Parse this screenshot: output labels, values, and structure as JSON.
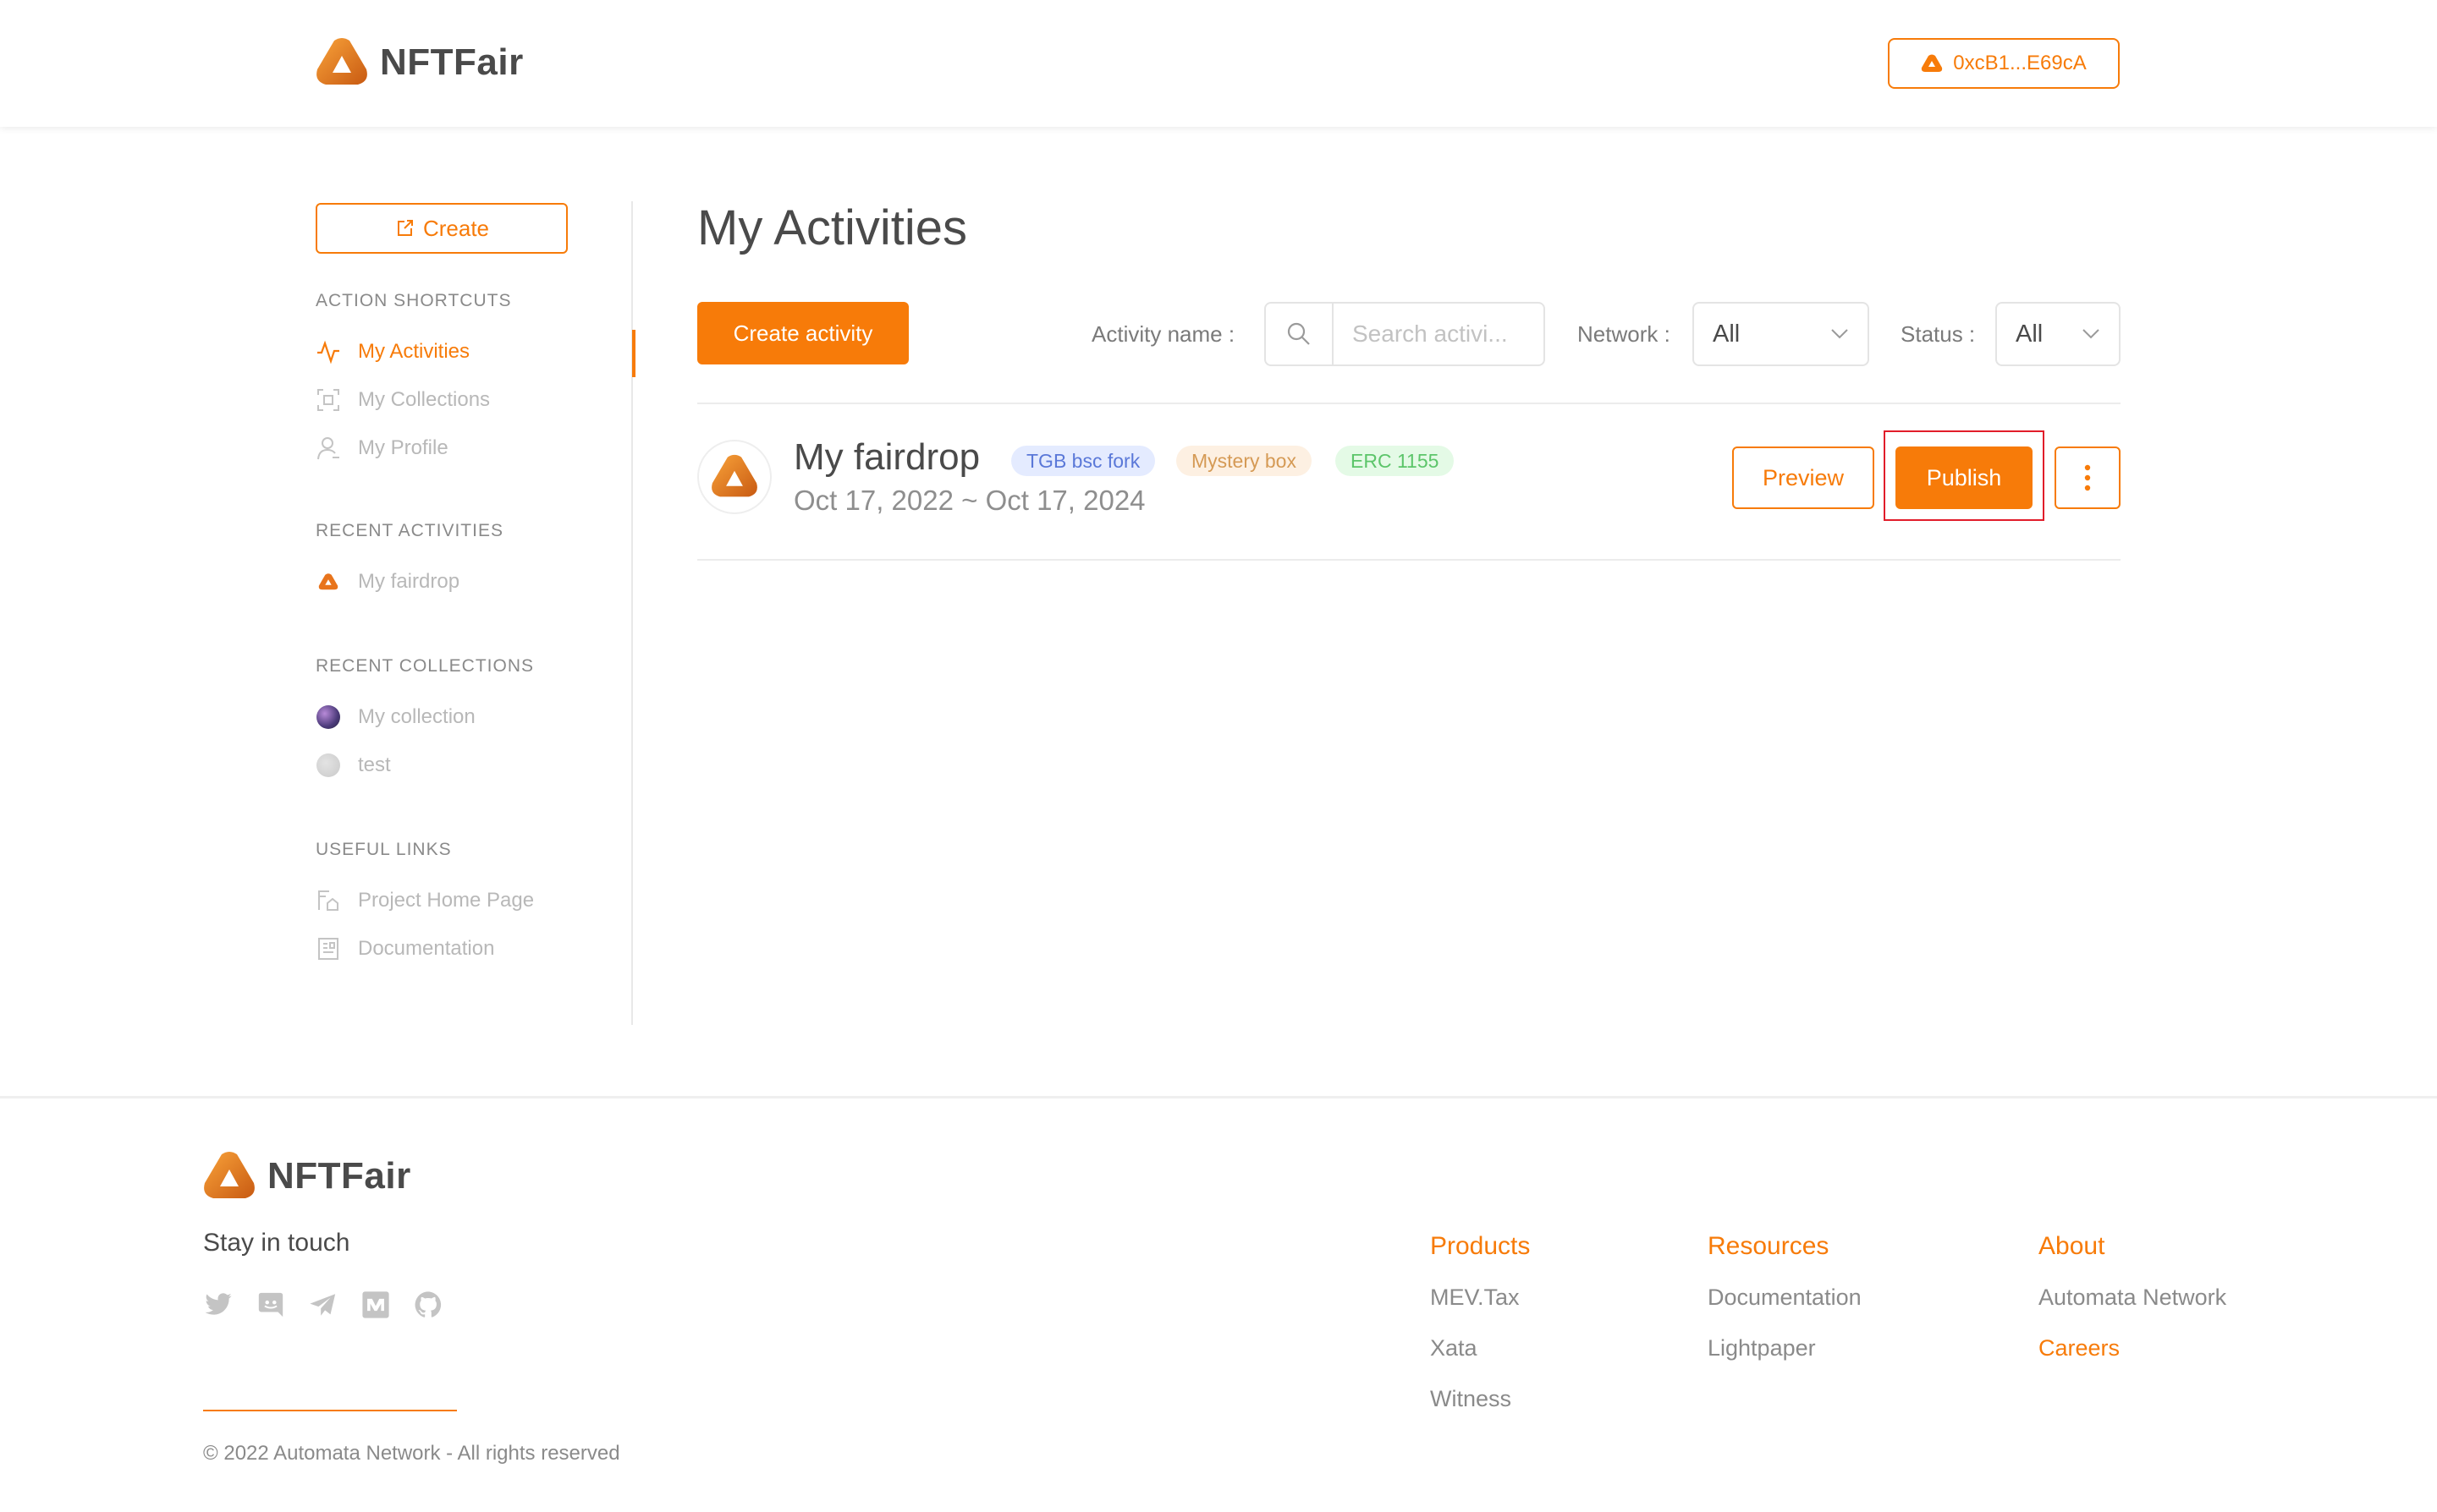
{
  "colors": {
    "accent": "#f77b09",
    "highlight_frame": "#e11d2a"
  },
  "brand": {
    "name": "NFTFair"
  },
  "header": {
    "wallet_address": "0xcB1...E69cA"
  },
  "sidebar": {
    "create_label": "Create",
    "sections": {
      "shortcuts_title": "ACTION SHORTCUTS",
      "recent_activities_title": "RECENT ACTIVITIES",
      "recent_collections_title": "RECENT COLLECTIONS",
      "useful_links_title": "USEFUL LINKS"
    },
    "shortcuts": [
      {
        "label": "My Activities",
        "icon": "activity-icon",
        "active": true
      },
      {
        "label": "My Collections",
        "icon": "collections-icon"
      },
      {
        "label": "My Profile",
        "icon": "profile-icon"
      }
    ],
    "recent_activities": [
      {
        "label": "My fairdrop",
        "icon": "fairdrop-logo-icon"
      }
    ],
    "recent_collections": [
      {
        "label": "My collection",
        "icon": "collection-avatar"
      },
      {
        "label": "test",
        "icon": "collection-avatar"
      }
    ],
    "useful_links": [
      {
        "label": "Project Home Page",
        "icon": "home-page-icon"
      },
      {
        "label": "Documentation",
        "icon": "documentation-icon"
      }
    ]
  },
  "main": {
    "title": "My Activities",
    "create_activity_label": "Create activity",
    "filters": {
      "activity_name_label": "Activity name :",
      "search_placeholder": "Search activi...",
      "network_label": "Network :",
      "network_value": "All",
      "status_label": "Status :",
      "status_value": "All"
    },
    "activities": [
      {
        "name": "My fairdrop",
        "dates": "Oct 17, 2022 ~ Oct 17, 2024",
        "tags": [
          "TGB bsc fork",
          "Mystery box",
          "ERC 1155"
        ],
        "preview_label": "Preview",
        "publish_label": "Publish"
      }
    ]
  },
  "footer": {
    "stay_in_touch": "Stay in touch",
    "socials": [
      "twitter-icon",
      "discord-icon",
      "telegram-icon",
      "medium-icon",
      "github-icon"
    ],
    "columns": [
      {
        "title": "Products",
        "links": [
          "MEV.Tax",
          "Xata",
          "Witness"
        ]
      },
      {
        "title": "Resources",
        "links": [
          "Documentation",
          "Lightpaper"
        ]
      },
      {
        "title": "About",
        "links": [
          "Automata Network",
          "Careers"
        ]
      }
    ],
    "copyright": "© 2022 Automata Network - All rights reserved"
  }
}
